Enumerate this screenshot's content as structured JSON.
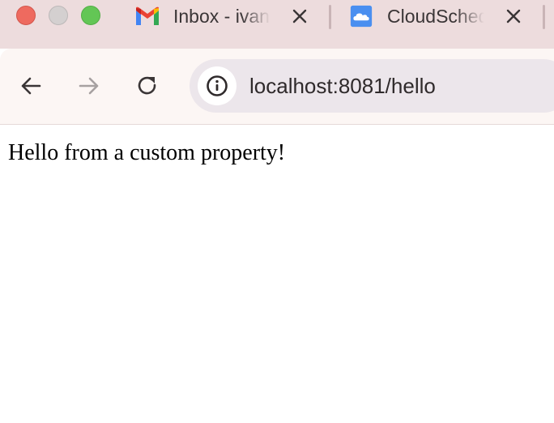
{
  "browser": {
    "window_controls": {
      "close": "close",
      "minimize": "minimize",
      "maximize": "maximize"
    },
    "tabs": [
      {
        "title": "Inbox - ivan",
        "favicon": "gmail-icon",
        "close_icon": "close-icon"
      },
      {
        "title": "CloudScheduler",
        "favicon": "cloud-icon",
        "close_icon": "close-icon"
      }
    ],
    "toolbar": {
      "back_icon": "arrow-left-icon",
      "forward_icon": "arrow-right-icon",
      "reload_icon": "reload-icon",
      "site_info_icon": "info-icon",
      "url": "localhost:8081/hello"
    },
    "colors": {
      "tabstrip": "#eddcdd",
      "toolbar": "#fcf6f4",
      "omnibox": "#ece6eb"
    }
  },
  "page": {
    "text": "Hello from a custom property!"
  }
}
